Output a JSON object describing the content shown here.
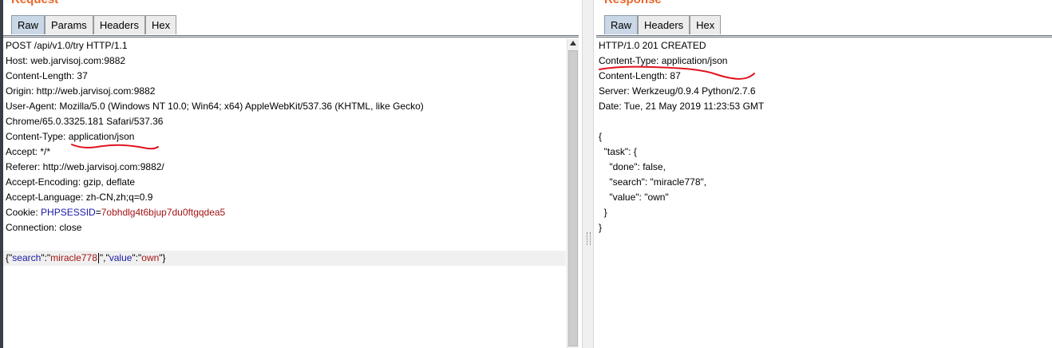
{
  "request": {
    "title": "Request",
    "tabs": [
      "Raw",
      "Params",
      "Headers",
      "Hex"
    ],
    "active_tab": "Raw",
    "lines": [
      "POST /api/v1.0/try HTTP/1.1",
      "Host: web.jarvisoj.com:9882",
      "Content-Length: 37",
      "Origin: http://web.jarvisoj.com:9882",
      "User-Agent: Mozilla/5.0 (Windows NT 10.0; Win64; x64) AppleWebKit/537.36 (KHTML, like Gecko)",
      "Chrome/65.0.3325.181 Safari/537.36",
      "Content-Type: application/json",
      "Accept: */*",
      "Referer: http://web.jarvisoj.com:9882/",
      "Accept-Encoding: gzip, deflate",
      "Accept-Language: zh-CN,zh;q=0.9"
    ],
    "cookie": {
      "prefix": "Cookie: ",
      "name": "PHPSESSID",
      "eq": "=",
      "value": "7obhdlg4t6bjup7du0ftgqdea5"
    },
    "connection": "Connection: close",
    "body": {
      "open": "{\"",
      "k1": "search",
      "sep1": "\":\"",
      "v1": "miracle778",
      "mid": "\",\"",
      "k2": "value",
      "sep2": "\":\"",
      "v2": "own",
      "close": "\"}"
    }
  },
  "response": {
    "title": "Response",
    "tabs": [
      "Raw",
      "Headers",
      "Hex"
    ],
    "active_tab": "Raw",
    "lines": [
      "HTTP/1.0 201 CREATED",
      "Content-Type: application/json",
      "Content-Length: 87",
      "Server: Werkzeug/0.9.4 Python/2.7.6",
      "Date: Tue, 21 May 2019 11:23:53 GMT",
      "",
      "{",
      "  \"task\": {",
      "    \"done\": false,",
      "    \"search\": \"miracle778\",",
      "    \"value\": \"own\"",
      "  }",
      "}"
    ]
  },
  "colors": {
    "annotation": "#e0141e",
    "title": "#e8672a",
    "active_tab": "#c9d7e6"
  }
}
